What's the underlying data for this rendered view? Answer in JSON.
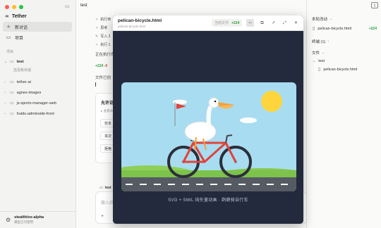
{
  "sidebar": {
    "app_name": "Tether",
    "new_chat": "新对话",
    "projects": "项目",
    "section_label": "项目",
    "project_list": [
      {
        "name": "test",
        "bold": true,
        "open": true
      },
      {
        "name": "tether-ai"
      },
      {
        "name": "agnes-images"
      },
      {
        "name": "js-sports-manager-web"
      },
      {
        "name": "huidu-adminside-front"
      }
    ],
    "sub_item": "还没有对话",
    "user_name": "stealth/ox-alpha",
    "user_sub": "模型已可使用"
  },
  "main": {
    "title": "test",
    "log": [
      {
        "icon": "✧",
        "text": "执行命"
      },
      {
        "icon": "✧",
        "text": "思考"
      },
      {
        "icon": "✎",
        "text": "写入 2"
      },
      {
        "icon": "✧",
        "text": "执行 1"
      }
    ],
    "running_text": "正在执行命",
    "diff_plus": "+224",
    "diff_minus": "-0",
    "file_created": "文件已创",
    "permission": {
      "title": "允许访",
      "subtitle": "查看命",
      "options": [
        "仅本",
        "本次",
        "拒绝"
      ]
    },
    "input": {
      "project": "test",
      "placeholder": "输入后"
    }
  },
  "right_panel": {
    "changes_title": "本轮改动",
    "changed_file": "pelican-bicycle.html",
    "changed_count": "+224",
    "terminal_title": "终端 (1)",
    "files_title": "文件",
    "folder": "test",
    "file": "pelican-bicycle.html"
  },
  "preview": {
    "title": "pelican-bicycle.html",
    "subtitle": "pelican-bicycle.html",
    "tab_current": "当前文件",
    "count": "+224",
    "caption": "SVG + SMIL 纯矢量动画 · 鹈鹕骑自行车"
  },
  "colors": {
    "accent_green": "#2a9d3f",
    "sky": "#a9dcf2",
    "grass": "#7dc24b",
    "road": "#555a63",
    "bike": "#e0433b",
    "sun": "#ffd53d"
  }
}
